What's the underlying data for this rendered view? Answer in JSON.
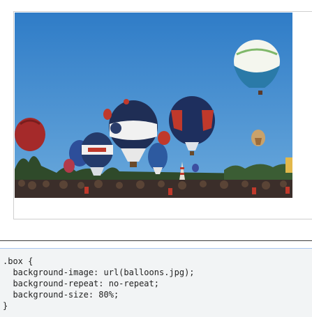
{
  "demo": {
    "image_name": "hot-air-balloons-photo",
    "sky_color_top": "#3a83c9",
    "sky_color_bottom": "#5aa0d8"
  },
  "code": {
    "lines": [
      ".box {",
      "  background-image: url(balloons.jpg);",
      "  background-repeat: no-repeat;",
      "  background-size: 80%;",
      "}"
    ]
  },
  "colors": {
    "panel_bg": "#f2f4f5",
    "panel_border": "#a9c7ef",
    "divider": "#3a3a3a"
  }
}
